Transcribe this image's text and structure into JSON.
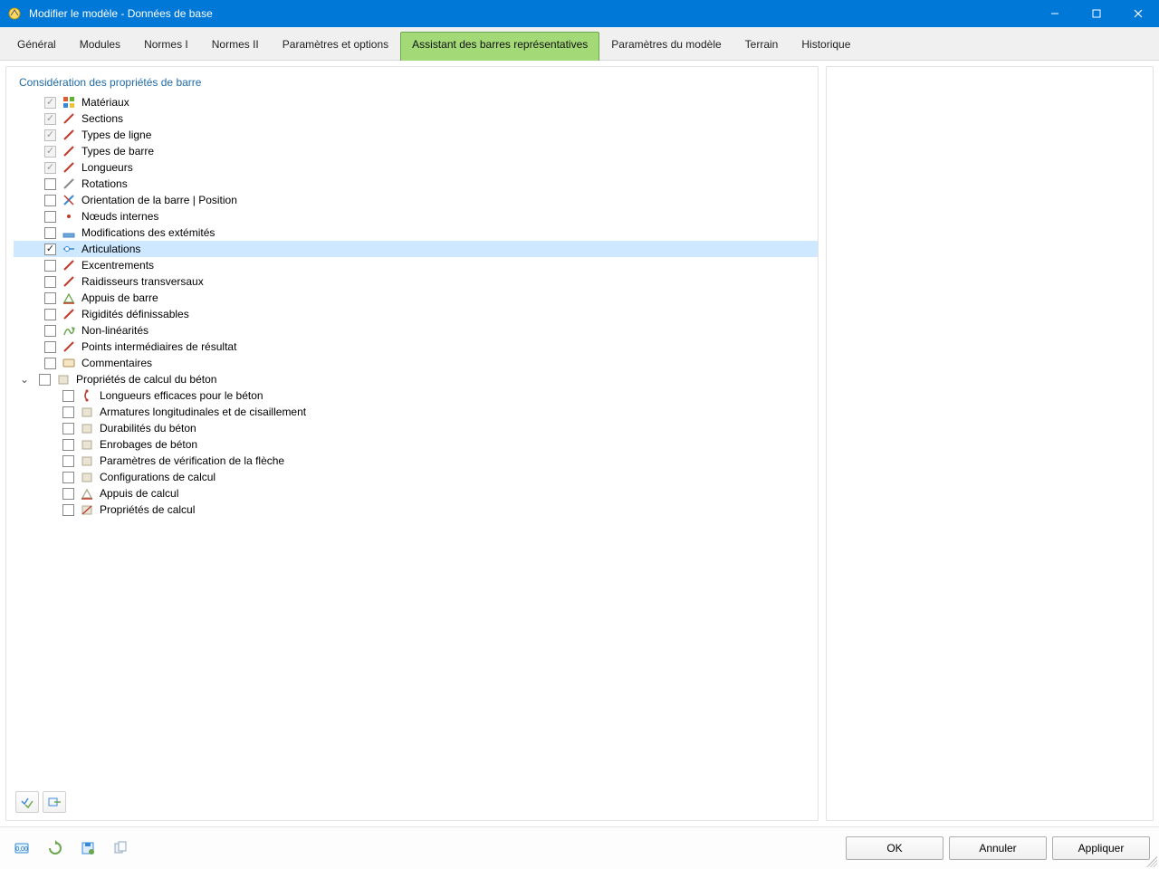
{
  "window": {
    "title": "Modifier le modèle - Données de base"
  },
  "tabs": [
    {
      "label": "Général"
    },
    {
      "label": "Modules"
    },
    {
      "label": "Normes I"
    },
    {
      "label": "Normes II"
    },
    {
      "label": "Paramètres et options"
    },
    {
      "label": "Assistant des barres représentatives",
      "active": true
    },
    {
      "label": "Paramètres du modèle"
    },
    {
      "label": "Terrain"
    },
    {
      "label": "Historique"
    }
  ],
  "section_title": "Considération des propriétés de barre",
  "tree": {
    "items": [
      {
        "label": "Matériaux",
        "checked": true,
        "disabled": true,
        "icon": "materials-icon"
      },
      {
        "label": "Sections",
        "checked": true,
        "disabled": true,
        "icon": "sections-icon"
      },
      {
        "label": "Types de ligne",
        "checked": true,
        "disabled": true,
        "icon": "line-type-icon"
      },
      {
        "label": "Types de barre",
        "checked": true,
        "disabled": true,
        "icon": "bar-type-icon"
      },
      {
        "label": "Longueurs",
        "checked": true,
        "disabled": true,
        "icon": "length-icon"
      },
      {
        "label": "Rotations",
        "checked": false,
        "disabled": false,
        "icon": "rotation-icon"
      },
      {
        "label": "Orientation de la barre | Position",
        "checked": false,
        "disabled": false,
        "icon": "orientation-icon"
      },
      {
        "label": "Nœuds internes",
        "checked": false,
        "disabled": false,
        "icon": "node-icon"
      },
      {
        "label": "Modifications des extémités",
        "checked": false,
        "disabled": false,
        "icon": "end-mod-icon"
      },
      {
        "label": "Articulations",
        "checked": true,
        "disabled": false,
        "icon": "hinge-icon",
        "selected": true
      },
      {
        "label": "Excentrements",
        "checked": false,
        "disabled": false,
        "icon": "eccentricity-icon"
      },
      {
        "label": "Raidisseurs transversaux",
        "checked": false,
        "disabled": false,
        "icon": "stiffener-icon"
      },
      {
        "label": "Appuis de barre",
        "checked": false,
        "disabled": false,
        "icon": "support-icon"
      },
      {
        "label": "Rigidités définissables",
        "checked": false,
        "disabled": false,
        "icon": "stiffness-icon"
      },
      {
        "label": "Non-linéarités",
        "checked": false,
        "disabled": false,
        "icon": "nonlinear-icon"
      },
      {
        "label": "Points intermédiaires de résultat",
        "checked": false,
        "disabled": false,
        "icon": "result-point-icon"
      },
      {
        "label": "Commentaires",
        "checked": false,
        "disabled": false,
        "icon": "comment-icon"
      }
    ],
    "group": {
      "label": "Propriétés de calcul du béton",
      "expanded": true,
      "checked": false,
      "icon": "concrete-icon",
      "children": [
        {
          "label": "Longueurs efficaces pour le béton",
          "checked": false,
          "icon": "eff-length-icon"
        },
        {
          "label": "Armatures longitudinales et de cisaillement",
          "checked": false,
          "icon": "rebar-icon"
        },
        {
          "label": "Durabilités du béton",
          "checked": false,
          "icon": "durability-icon"
        },
        {
          "label": "Enrobages de béton",
          "checked": false,
          "icon": "cover-icon"
        },
        {
          "label": "Paramètres de vérification de la flèche",
          "checked": false,
          "icon": "deflection-icon"
        },
        {
          "label": "Configurations de calcul",
          "checked": false,
          "icon": "calc-config-icon"
        },
        {
          "label": "Appuis de calcul",
          "checked": false,
          "icon": "calc-support-icon"
        },
        {
          "label": "Propriétés de calcul",
          "checked": false,
          "icon": "calc-prop-icon"
        }
      ]
    }
  },
  "footer": {
    "ok": "OK",
    "cancel": "Annuler",
    "apply": "Appliquer"
  },
  "icon_colors": {
    "materials-icon": [
      "#e15b2e",
      "#5bb531",
      "#3a89d8",
      "#f1c232"
    ],
    "sections-icon": [
      "#c0392b"
    ],
    "line-type-icon": [
      "#c0392b"
    ],
    "bar-type-icon": [
      "#c0392b"
    ],
    "length-icon": [
      "#c0392b"
    ],
    "rotation-icon": [
      "#888888"
    ],
    "orientation-icon": [
      "#3a89d8",
      "#c0392b"
    ],
    "node-icon": [
      "#c0392b"
    ],
    "end-mod-icon": [
      "#6fa8dc"
    ],
    "hinge-icon": [
      "#3a89d8"
    ],
    "eccentricity-icon": [
      "#c0392b"
    ],
    "stiffener-icon": [
      "#c0392b"
    ],
    "support-icon": [
      "#6aa84f",
      "#c0392b"
    ],
    "stiffness-icon": [
      "#c0392b"
    ],
    "nonlinear-icon": [
      "#6aa84f"
    ],
    "result-point-icon": [
      "#c0392b"
    ],
    "comment-icon": [
      "#b08b55"
    ],
    "concrete-icon": [
      "#b0a98f"
    ],
    "eff-length-icon": [
      "#c0392b"
    ],
    "rebar-icon": [
      "#b0a98f"
    ],
    "durability-icon": [
      "#b0a98f"
    ],
    "cover-icon": [
      "#b0a98f"
    ],
    "deflection-icon": [
      "#b0a98f"
    ],
    "calc-config-icon": [
      "#b0a98f"
    ],
    "calc-support-icon": [
      "#b0a98f",
      "#c0392b"
    ],
    "calc-prop-icon": [
      "#b0a98f",
      "#c0392b"
    ]
  }
}
